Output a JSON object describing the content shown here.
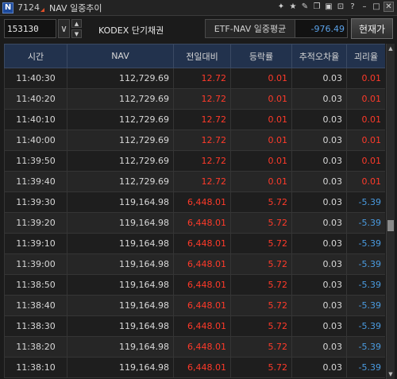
{
  "window": {
    "app_badge": "N",
    "screen_number": "7124",
    "title": "NAV 일중추이",
    "icons": [
      "pin-icon",
      "star-icon",
      "tools-icon",
      "copy-icon",
      "window-icon",
      "lock-icon",
      "help-icon",
      "minimize-icon",
      "maximize-icon",
      "close-icon"
    ]
  },
  "toolbar": {
    "stock_code": "153130",
    "stock_name": "KODEX 단기채권",
    "nav_label": "ETF-NAV 일중평균",
    "nav_value": "-976.49",
    "current_button": "현재가"
  },
  "table": {
    "headers": [
      "시간",
      "NAV",
      "전일대비",
      "등락률",
      "추적오차율",
      "괴리율"
    ],
    "rows": [
      {
        "time": "11:40:30",
        "nav": "112,729.69",
        "change": "12.72",
        "rate": "0.01",
        "tracking": "0.03",
        "disparity": "0.01",
        "disparity_color": "red"
      },
      {
        "time": "11:40:20",
        "nav": "112,729.69",
        "change": "12.72",
        "rate": "0.01",
        "tracking": "0.03",
        "disparity": "0.01",
        "disparity_color": "red"
      },
      {
        "time": "11:40:10",
        "nav": "112,729.69",
        "change": "12.72",
        "rate": "0.01",
        "tracking": "0.03",
        "disparity": "0.01",
        "disparity_color": "red"
      },
      {
        "time": "11:40:00",
        "nav": "112,729.69",
        "change": "12.72",
        "rate": "0.01",
        "tracking": "0.03",
        "disparity": "0.01",
        "disparity_color": "red"
      },
      {
        "time": "11:39:50",
        "nav": "112,729.69",
        "change": "12.72",
        "rate": "0.01",
        "tracking": "0.03",
        "disparity": "0.01",
        "disparity_color": "red"
      },
      {
        "time": "11:39:40",
        "nav": "112,729.69",
        "change": "12.72",
        "rate": "0.01",
        "tracking": "0.03",
        "disparity": "0.01",
        "disparity_color": "red"
      },
      {
        "time": "11:39:30",
        "nav": "119,164.98",
        "change": "6,448.01",
        "rate": "5.72",
        "tracking": "0.03",
        "disparity": "-5.39",
        "disparity_color": "blue"
      },
      {
        "time": "11:39:20",
        "nav": "119,164.98",
        "change": "6,448.01",
        "rate": "5.72",
        "tracking": "0.03",
        "disparity": "-5.39",
        "disparity_color": "blue"
      },
      {
        "time": "11:39:10",
        "nav": "119,164.98",
        "change": "6,448.01",
        "rate": "5.72",
        "tracking": "0.03",
        "disparity": "-5.39",
        "disparity_color": "blue"
      },
      {
        "time": "11:39:00",
        "nav": "119,164.98",
        "change": "6,448.01",
        "rate": "5.72",
        "tracking": "0.03",
        "disparity": "-5.39",
        "disparity_color": "blue"
      },
      {
        "time": "11:38:50",
        "nav": "119,164.98",
        "change": "6,448.01",
        "rate": "5.72",
        "tracking": "0.03",
        "disparity": "-5.39",
        "disparity_color": "blue"
      },
      {
        "time": "11:38:40",
        "nav": "119,164.98",
        "change": "6,448.01",
        "rate": "5.72",
        "tracking": "0.03",
        "disparity": "-5.39",
        "disparity_color": "blue"
      },
      {
        "time": "11:38:30",
        "nav": "119,164.98",
        "change": "6,448.01",
        "rate": "5.72",
        "tracking": "0.03",
        "disparity": "-5.39",
        "disparity_color": "blue"
      },
      {
        "time": "11:38:20",
        "nav": "119,164.98",
        "change": "6,448.01",
        "rate": "5.72",
        "tracking": "0.03",
        "disparity": "-5.39",
        "disparity_color": "blue"
      },
      {
        "time": "11:38:10",
        "nav": "119,164.98",
        "change": "6,448.01",
        "rate": "5.72",
        "tracking": "0.03",
        "disparity": "-5.39",
        "disparity_color": "blue"
      }
    ]
  },
  "colors": {
    "header_bg": "#22324d",
    "up": "#ff3a2a",
    "down": "#4a9be0",
    "nav_value": "#5aa0e6"
  }
}
